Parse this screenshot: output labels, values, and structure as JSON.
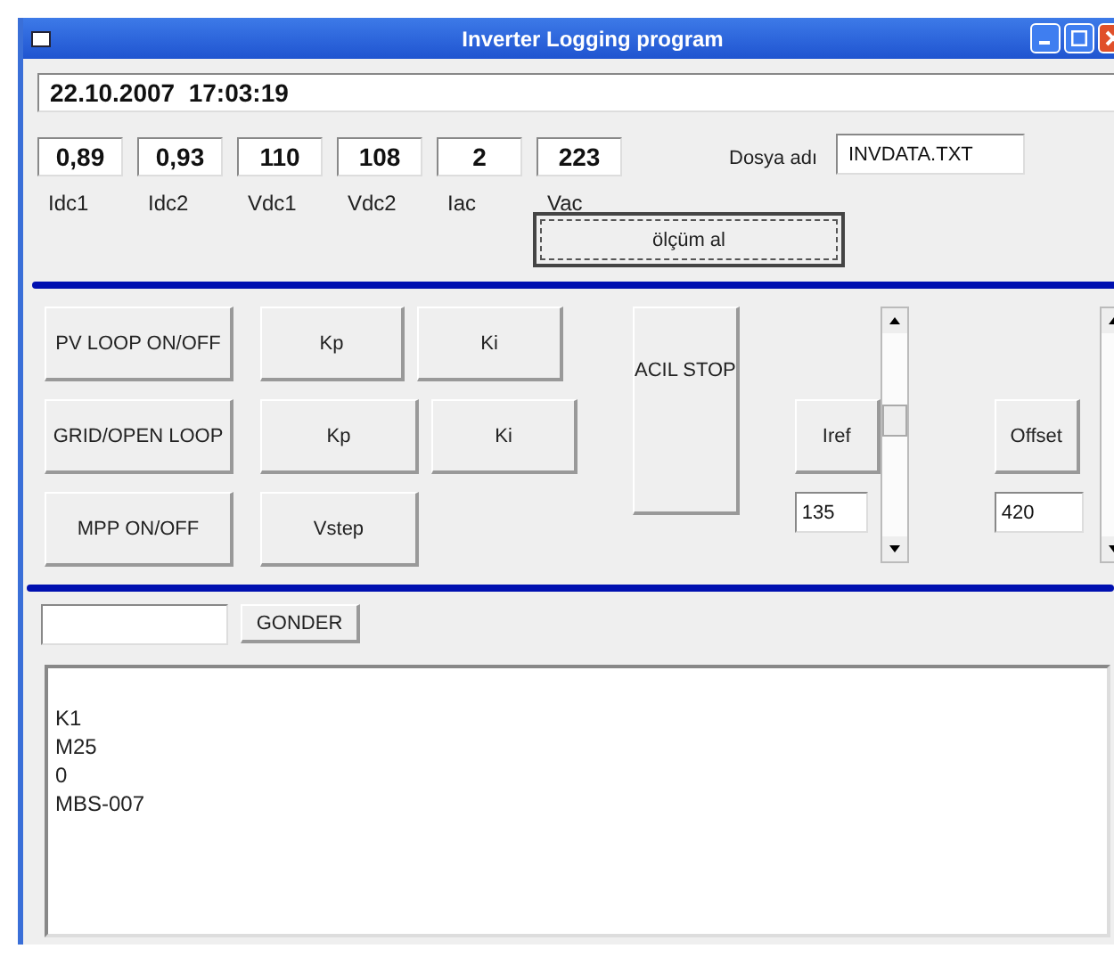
{
  "window": {
    "title": "Inverter Logging program"
  },
  "datetime": "22.10.2007  17:03:19",
  "readings": [
    {
      "value": "0,89",
      "label": "Idc1"
    },
    {
      "value": "0,93",
      "label": "Idc2"
    },
    {
      "value": "110",
      "label": "Vdc1"
    },
    {
      "value": "108",
      "label": "Vdc2"
    },
    {
      "value": "2",
      "label": "Iac"
    },
    {
      "value": "223",
      "label": "Vac"
    }
  ],
  "file": {
    "label": "Dosya adı",
    "value": "INVDATA.TXT"
  },
  "measure_button": "ölçüm al",
  "control_rows": [
    [
      "PV LOOP ON/OFF",
      "Kp",
      "Ki"
    ],
    [
      "GRID/OPEN LOOP",
      "Kp",
      "Ki"
    ],
    [
      "MPP ON/OFF",
      "Vstep"
    ]
  ],
  "stop_button": "ACIL STOP",
  "setpoints": [
    {
      "button": "Iref",
      "value": "135"
    },
    {
      "button": "Offset",
      "value": "420"
    }
  ],
  "send_button": "GONDER",
  "log": [
    "K1",
    "M25",
    "0",
    "MBS-007"
  ]
}
